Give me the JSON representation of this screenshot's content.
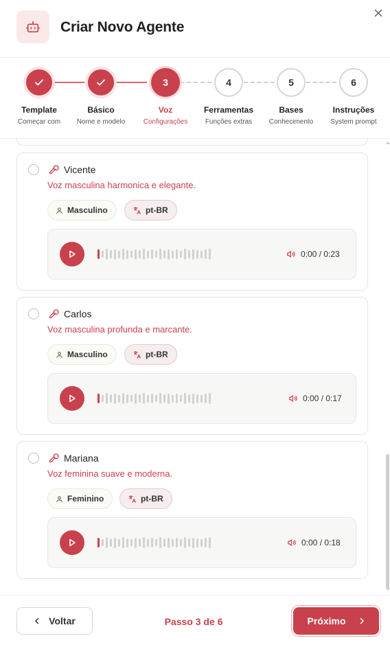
{
  "header": {
    "title": "Criar Novo Agente",
    "icon": "robot-icon",
    "close_icon": "close-icon"
  },
  "stepper": {
    "steps": [
      {
        "number": "1",
        "name": "Template",
        "sub": "Começar com",
        "state": "done"
      },
      {
        "number": "2",
        "name": "Básico",
        "sub": "Nome e modelo",
        "state": "done"
      },
      {
        "number": "3",
        "name": "Voz",
        "sub": "Configurações",
        "state": "active"
      },
      {
        "number": "4",
        "name": "Ferramentas",
        "sub": "Funções extras",
        "state": "todo"
      },
      {
        "number": "5",
        "name": "Bases",
        "sub": "Conhecimento",
        "state": "todo"
      },
      {
        "number": "6",
        "name": "Instruções",
        "sub": "System prompt",
        "state": "todo"
      }
    ]
  },
  "voices": [
    {
      "name": "Vicente",
      "description": "Voz masculina harmonica e elegante.",
      "gender": "Masculino",
      "language": "pt-BR",
      "time": "0:00 / 0:23",
      "progress": 0
    },
    {
      "name": "Carlos",
      "description": "Voz masculina profunda e marcante.",
      "gender": "Masculino",
      "language": "pt-BR",
      "time": "0:00 / 0:17",
      "progress": 0
    },
    {
      "name": "Mariana",
      "description": "Voz feminina suave e moderna.",
      "gender": "Feminino",
      "language": "pt-BR",
      "time": "0:00 / 0:18",
      "progress": 0
    }
  ],
  "footer": {
    "back_label": "Voltar",
    "step_text": "Passo 3 de 6",
    "next_label": "Próximo"
  },
  "colors": {
    "accent": "#c8414c",
    "accent_soft": "#fbe9ea"
  }
}
